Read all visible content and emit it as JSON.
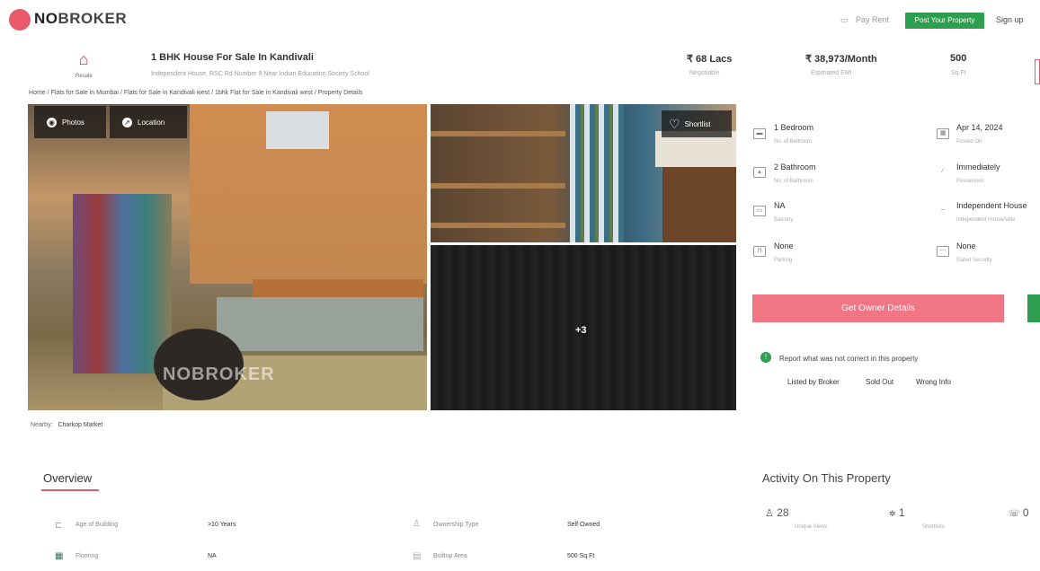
{
  "header": {
    "logo_no": "NO",
    "logo_broker": "BROKER",
    "pay_rent": "Pay Rent",
    "post_property": "Post Your Property",
    "sign_up": "Sign up"
  },
  "property": {
    "badge": "Resale",
    "title": "1 BHK House For Sale In Kandivali",
    "subtitle": "Independent House, RSC Rd Number 9 Near Indian Education Society School",
    "price": "₹ 68 Lacs",
    "price_sub": "Negotiable",
    "emi": "₹ 38,973/Month",
    "emi_sub": "Estimated EMI",
    "area": "500",
    "area_sub": "Sq.Ft"
  },
  "breadcrumb": "Home / Flats for Sale in Mumbai / Flats for Sale in Kandivali west / 1bhk Flat for Sale in Kandivali west / Property Details",
  "gallery": {
    "photos_tab": "Photos",
    "location_tab": "Location",
    "shortlist": "Shortlist",
    "more_count": "+3",
    "watermark": "NOBROKER"
  },
  "nearby": {
    "label": "Nearby:",
    "value": "Charkop Market"
  },
  "details": [
    {
      "icon": "bed-icon",
      "value": "1 Bedroom",
      "sub": "No. of Bedroom"
    },
    {
      "icon": "calendar-icon",
      "value": "Apr 14, 2024",
      "sub": "Posted On"
    },
    {
      "icon": "bath-icon",
      "value": "2 Bathroom",
      "sub": "No. of Bathroom"
    },
    {
      "icon": "key-icon",
      "value": "Immediately",
      "sub": "Possession"
    },
    {
      "icon": "balcony-icon",
      "value": "NA",
      "sub": "Balcony"
    },
    {
      "icon": "house-icon",
      "value": "Independent House",
      "sub": "Independent House/Villa"
    },
    {
      "icon": "car-icon",
      "value": "None",
      "sub": "Parking"
    },
    {
      "icon": "gate-icon",
      "value": "None",
      "sub": "Gated Security"
    }
  ],
  "actions": {
    "get_owner": "Get Owner Details",
    "report": "Report what was not correct in this property",
    "opt_broker": "Listed by Broker",
    "opt_sold": "Sold Out",
    "opt_wrong": "Wrong Info"
  },
  "overview": {
    "title": "Overview",
    "rows": [
      {
        "label": "Age of Building",
        "value": ">10 Years",
        "label2": "Ownership Type",
        "value2": "Self Owned"
      },
      {
        "label": "Flooring",
        "value": "NA",
        "label2": "Builtup Area",
        "value2": "500 Sq.Ft"
      }
    ]
  },
  "activity": {
    "title": "Activity On This Property",
    "views": "28",
    "views_sub": "Unique Views",
    "shortlists": "1",
    "shortlists_sub": "Shortlists",
    "contacts": "0"
  },
  "colors": {
    "brand": "#e8596b",
    "green": "#2e9e4f",
    "owner_button": "#f07684"
  }
}
